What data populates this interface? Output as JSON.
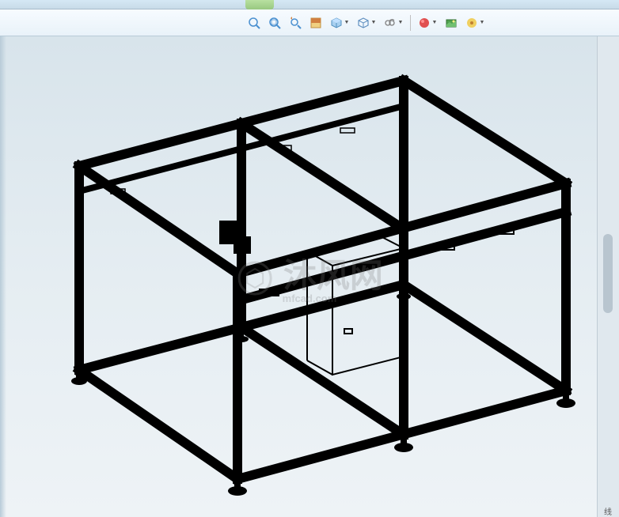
{
  "toolbar": {
    "tools": [
      {
        "name": "zoom-fit",
        "color": "#4a90d0"
      },
      {
        "name": "zoom-area",
        "color": "#4a90d0"
      },
      {
        "name": "zoom-previous",
        "color": "#4a90d0"
      },
      {
        "name": "section-view",
        "color": "#d08040"
      },
      {
        "name": "view-orientation",
        "color": "#70a8e0"
      },
      {
        "name": "display-style",
        "color": "#80b8f0"
      },
      {
        "name": "hide-show",
        "color": "#808080"
      },
      {
        "name": "edit-appearance",
        "color": "#c05050"
      },
      {
        "name": "apply-scene",
        "color": "#50c050"
      },
      {
        "name": "view-settings",
        "color": "#e0b040"
      }
    ]
  },
  "watermark": {
    "main": "沐风网",
    "sub": "mfcad.com"
  },
  "status": {
    "corner": "线"
  },
  "model": {
    "description": "black_frame_structure_isometric",
    "display_style": "wireframe_hidden_lines"
  }
}
